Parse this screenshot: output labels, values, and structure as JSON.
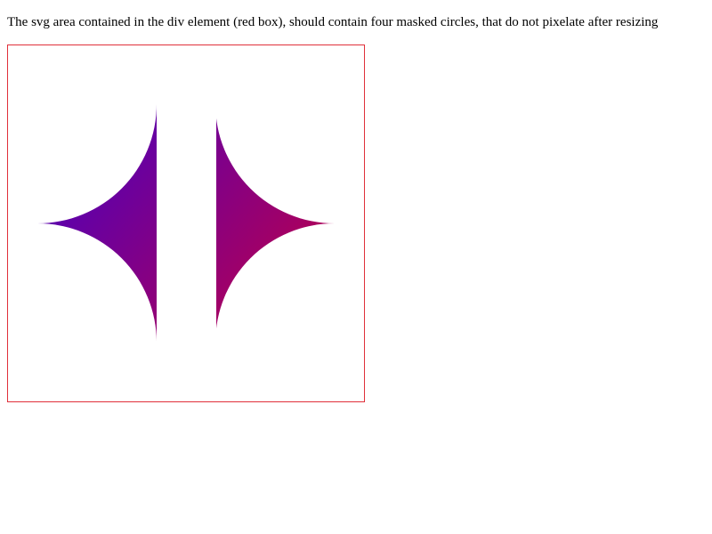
{
  "page": {
    "intro_text": "The svg area contained in the div element (red box), should contain four masked circles, that do not pixelate after resizing"
  },
  "colors": {
    "box_border": "#e0303a",
    "gradient_start": "#4000c8",
    "gradient_end": "#c80040",
    "background": "#ffffff"
  }
}
